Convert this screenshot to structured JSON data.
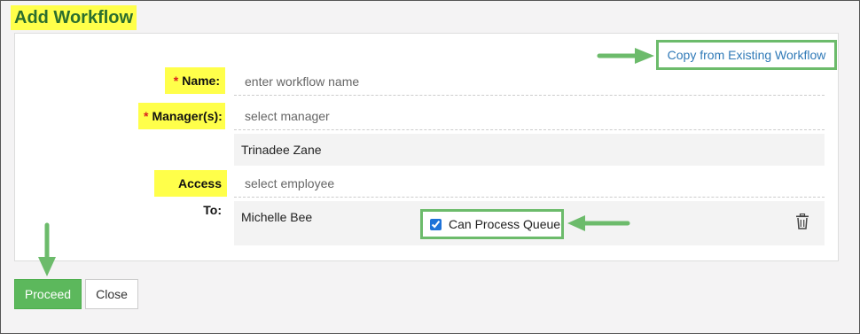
{
  "title": "Add Workflow",
  "copy_link": "Copy from Existing Workflow",
  "fields": {
    "required_marker": "*",
    "name_label": "Name:",
    "name_placeholder": "enter workflow name",
    "manager_label": "Manager(s):",
    "manager_placeholder": "select manager",
    "manager_selected": "Trinadee Zane",
    "access_label": "Access To:",
    "access_placeholder": "select employee"
  },
  "access_entry": {
    "name": "Michelle Bee",
    "permission_label": "Can Process Queue",
    "permission_checked": true
  },
  "buttons": {
    "proceed": "Proceed",
    "close": "Close"
  },
  "colors": {
    "highlight": "#ffff4a",
    "title_text": "#2c6e2e",
    "annotation_green": "#6cbb6b",
    "link": "#2f79b7",
    "required": "#d9211e",
    "proceed_bg": "#5cb85c"
  },
  "icons": {
    "delete": "trash-icon",
    "annotation": "arrow-icon"
  }
}
